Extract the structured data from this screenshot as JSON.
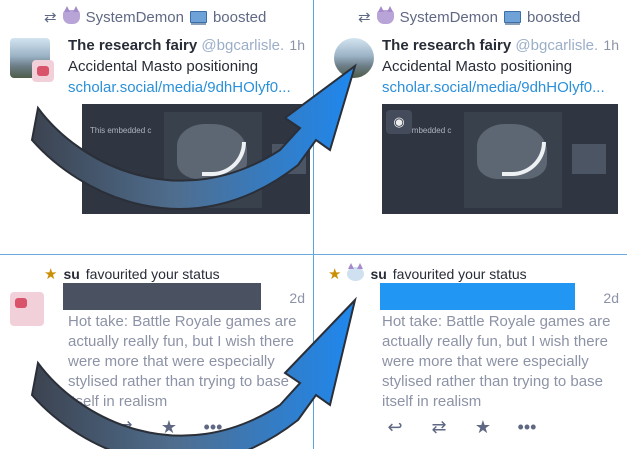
{
  "boost": {
    "user": "SystemDemon",
    "label": "boosted"
  },
  "post": {
    "display_name": "The research fairy",
    "handle": "@bgcarlisle...",
    "time": "1h",
    "text": "Accidental Masto positioning",
    "link": "scholar.social/media/9dhHOlyf0...",
    "media_caption": "This embedded c"
  },
  "notification": {
    "user": "su",
    "action": "favourited your status",
    "time": "2d",
    "status_text": "Hot take: Battle Royale games are actually really fun, but I wish there were more that were especially stylised rather than trying to base itself in realism"
  },
  "icons": {
    "reply": "reply-icon",
    "boost": "boost-icon",
    "favourite": "star-icon",
    "more": "more-icon",
    "arrow": "curved-arrow-icon"
  },
  "colors": {
    "accent": "#2b90d9",
    "star": "#ca8f04",
    "redact_dark": "#4a5160",
    "redact_blue": "#2196f3"
  }
}
